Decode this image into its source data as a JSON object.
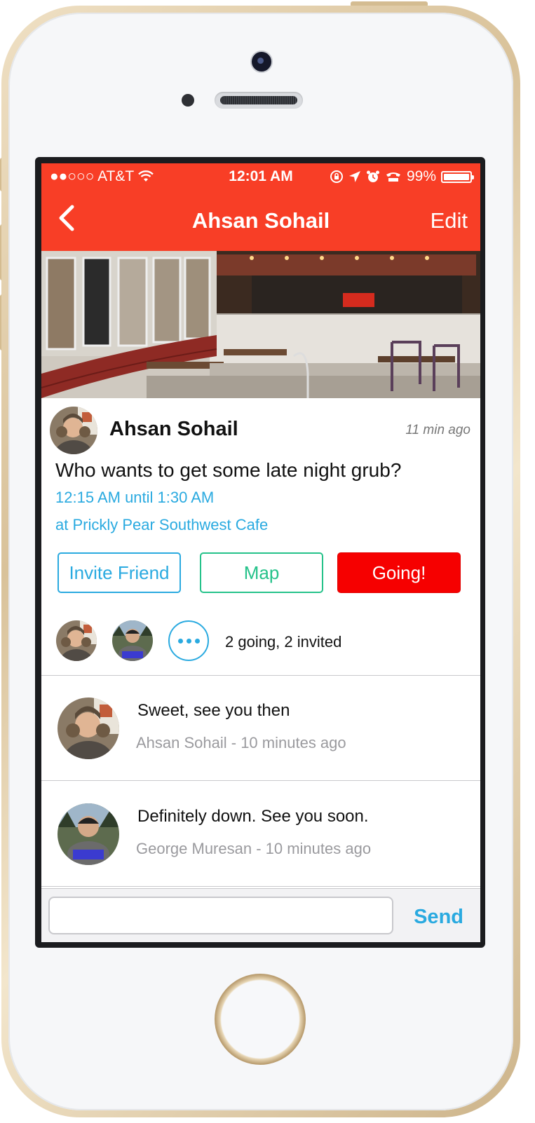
{
  "status_bar": {
    "carrier": "●●○○○ AT&T",
    "time": "12:01 AM",
    "battery": "99%"
  },
  "nav": {
    "title": "Ahsan Sohail",
    "edit_label": "Edit",
    "back_icon": "chevron-left-icon"
  },
  "post": {
    "author": "Ahsan Sohail",
    "time_ago": "11 min ago",
    "message": "Who wants to get some late night grub?",
    "when": "12:15 AM until 1:30 AM",
    "where": "at Prickly Pear Southwest Cafe"
  },
  "actions": {
    "invite_label": "Invite Friend",
    "map_label": "Map",
    "going_label": "Going!"
  },
  "attendees": {
    "summary": "2 going, 2 invited"
  },
  "comments": [
    {
      "text": "Sweet, see you then",
      "meta": "Ahsan Sohail - 10 minutes ago"
    },
    {
      "text": "Definitely down. See you soon.",
      "meta": "George Muresan - 10 minutes ago"
    }
  ],
  "compose": {
    "placeholder": "",
    "send_label": "Send"
  },
  "colors": {
    "accent": "#f83e26",
    "link": "#2aaae0",
    "map": "#25c28a",
    "going": "#f60000"
  }
}
